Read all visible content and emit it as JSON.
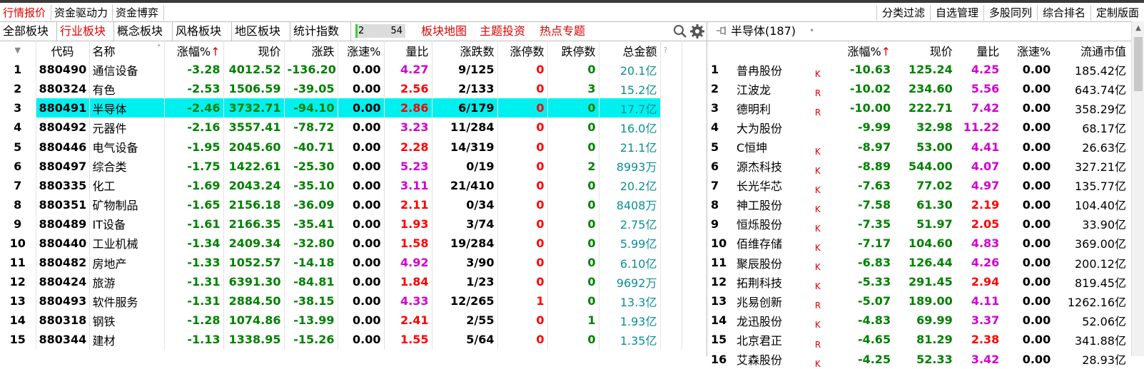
{
  "top_tabs": [
    {
      "label": "行情报价",
      "active": true
    },
    {
      "label": "资金驱动力",
      "active": false
    },
    {
      "label": "资金博弈",
      "active": false
    }
  ],
  "right_buttons": [
    "分类过滤",
    "自选管理",
    "多股同列",
    "综合排名",
    "定制版面"
  ],
  "board_tabs": [
    {
      "label": "全部板块",
      "active": false
    },
    {
      "label": "行业板块",
      "active": true
    },
    {
      "label": "概念板块",
      "active": false
    },
    {
      "label": "风格板块",
      "active": false
    },
    {
      "label": "地区板块",
      "active": false
    },
    {
      "label": "统计指数",
      "active": false
    }
  ],
  "progress": {
    "current": "2",
    "total": "54",
    "fraction": 0.04
  },
  "red_links": [
    "板块地图",
    "主题投资",
    "热点专题"
  ],
  "icons": {
    "search": "search-icon",
    "settings": "gear-icon",
    "pin": "pin-icon",
    "scroll_up": "chevron-up-icon"
  },
  "colors": {
    "up": "#ff0000",
    "down": "#008000",
    "ratio": "#d000d0",
    "amount": "#0a8f94",
    "selection": "#00f0f0",
    "active_tab": "#e00000"
  },
  "left_table": {
    "headers": [
      "",
      "代码",
      "名称",
      "涨幅%",
      "现价",
      "涨跌",
      "涨速%",
      "量比",
      "涨跌数",
      "涨停数",
      "跌停数",
      "总金额",
      "?"
    ],
    "sort_arrow": "↑",
    "selected_index": 2,
    "rows": [
      {
        "idx": "1",
        "code": "880490",
        "name": "通信设备",
        "pct": "-3.28",
        "price": "4012.52",
        "chg": "-136.20",
        "speed": "0.00",
        "ratio": "4.27",
        "ratio_color": "mag",
        "updown": "9/125",
        "limit_up": "0",
        "limit_down": "0",
        "amount": "20.1亿"
      },
      {
        "idx": "2",
        "code": "880324",
        "name": "有色",
        "pct": "-2.53",
        "price": "1506.59",
        "chg": "-39.05",
        "speed": "0.00",
        "ratio": "2.56",
        "ratio_color": "red",
        "updown": "2/133",
        "limit_up": "0",
        "limit_down": "3",
        "amount": "15.2亿"
      },
      {
        "idx": "3",
        "code": "880491",
        "name": "半导体",
        "pct": "-2.46",
        "price": "3732.71",
        "chg": "-94.10",
        "speed": "0.00",
        "ratio": "2.86",
        "ratio_color": "red",
        "updown": "6/179",
        "limit_up": "0",
        "limit_down": "0",
        "amount": "17.7亿"
      },
      {
        "idx": "4",
        "code": "880492",
        "name": "元器件",
        "pct": "-2.16",
        "price": "3557.41",
        "chg": "-78.72",
        "speed": "0.00",
        "ratio": "3.23",
        "ratio_color": "mag",
        "updown": "11/284",
        "limit_up": "0",
        "limit_down": "0",
        "amount": "16.0亿"
      },
      {
        "idx": "5",
        "code": "880446",
        "name": "电气设备",
        "pct": "-1.95",
        "price": "2045.60",
        "chg": "-40.71",
        "speed": "0.00",
        "ratio": "2.28",
        "ratio_color": "red",
        "updown": "14/319",
        "limit_up": "0",
        "limit_down": "0",
        "amount": "21.1亿"
      },
      {
        "idx": "6",
        "code": "880497",
        "name": "综合类",
        "pct": "-1.75",
        "price": "1422.61",
        "chg": "-25.30",
        "speed": "0.00",
        "ratio": "5.23",
        "ratio_color": "mag",
        "updown": "0/19",
        "limit_up": "0",
        "limit_down": "2",
        "amount": "8993万"
      },
      {
        "idx": "7",
        "code": "880335",
        "name": "化工",
        "pct": "-1.69",
        "price": "2043.24",
        "chg": "-35.10",
        "speed": "0.00",
        "ratio": "3.11",
        "ratio_color": "mag",
        "updown": "21/410",
        "limit_up": "0",
        "limit_down": "0",
        "amount": "20.2亿"
      },
      {
        "idx": "8",
        "code": "880351",
        "name": "矿物制品",
        "pct": "-1.65",
        "price": "2156.18",
        "chg": "-36.09",
        "speed": "0.00",
        "ratio": "2.11",
        "ratio_color": "red",
        "updown": "0/34",
        "limit_up": "0",
        "limit_down": "0",
        "amount": "8408万"
      },
      {
        "idx": "9",
        "code": "880489",
        "name": "IT设备",
        "pct": "-1.61",
        "price": "2166.35",
        "chg": "-35.41",
        "speed": "0.00",
        "ratio": "1.93",
        "ratio_color": "red",
        "updown": "3/74",
        "limit_up": "0",
        "limit_down": "0",
        "amount": "2.75亿"
      },
      {
        "idx": "10",
        "code": "880440",
        "name": "工业机械",
        "pct": "-1.34",
        "price": "2409.34",
        "chg": "-32.80",
        "speed": "0.00",
        "ratio": "1.58",
        "ratio_color": "red",
        "updown": "19/284",
        "limit_up": "0",
        "limit_down": "0",
        "amount": "5.99亿"
      },
      {
        "idx": "11",
        "code": "880482",
        "name": "房地产",
        "pct": "-1.33",
        "price": "1052.57",
        "chg": "-14.18",
        "speed": "0.00",
        "ratio": "4.92",
        "ratio_color": "mag",
        "updown": "3/90",
        "limit_up": "0",
        "limit_down": "0",
        "amount": "6.10亿"
      },
      {
        "idx": "12",
        "code": "880424",
        "name": "旅游",
        "pct": "-1.31",
        "price": "6391.30",
        "chg": "-84.81",
        "speed": "0.00",
        "ratio": "1.84",
        "ratio_color": "red",
        "updown": "1/23",
        "limit_up": "0",
        "limit_down": "0",
        "amount": "9692万"
      },
      {
        "idx": "13",
        "code": "880493",
        "name": "软件服务",
        "pct": "-1.31",
        "price": "2884.50",
        "chg": "-38.15",
        "speed": "0.00",
        "ratio": "4.33",
        "ratio_color": "mag",
        "updown": "12/265",
        "limit_up": "1",
        "limit_down": "0",
        "amount": "13.3亿"
      },
      {
        "idx": "14",
        "code": "880318",
        "name": "钢铁",
        "pct": "-1.28",
        "price": "1074.86",
        "chg": "-13.99",
        "speed": "0.00",
        "ratio": "2.41",
        "ratio_color": "red",
        "updown": "2/55",
        "limit_up": "0",
        "limit_down": "1",
        "amount": "1.93亿"
      },
      {
        "idx": "15",
        "code": "880344",
        "name": "建材",
        "pct": "-1.13",
        "price": "1338.95",
        "chg": "-15.26",
        "speed": "0.00",
        "ratio": "1.55",
        "ratio_color": "red",
        "updown": "5/64",
        "limit_up": "0",
        "limit_down": "0",
        "amount": "1.35亿"
      }
    ]
  },
  "right_table": {
    "title": "半导体(187)",
    "headers": [
      "涨幅%",
      "现价",
      "量比",
      "涨速%",
      "流通市值"
    ],
    "sort_arrow": "↑",
    "rows": [
      {
        "idx": "1",
        "name": "普冉股份",
        "tag": "K",
        "pct": "-10.63",
        "price": "125.24",
        "ratio": "4.25",
        "ratio_color": "mag",
        "speed": "0.00",
        "cap": "185.42亿"
      },
      {
        "idx": "2",
        "name": "江波龙",
        "tag": "R",
        "pct": "-10.02",
        "price": "234.60",
        "ratio": "5.56",
        "ratio_color": "mag",
        "speed": "0.00",
        "cap": "643.74亿"
      },
      {
        "idx": "3",
        "name": "德明利",
        "tag": "R",
        "pct": "-10.00",
        "price": "222.71",
        "ratio": "7.42",
        "ratio_color": "mag",
        "speed": "0.00",
        "cap": "358.29亿"
      },
      {
        "idx": "4",
        "name": "大为股份",
        "tag": "",
        "pct": "-9.99",
        "price": "32.98",
        "ratio": "11.22",
        "ratio_color": "mag",
        "speed": "0.00",
        "cap": "68.17亿"
      },
      {
        "idx": "5",
        "name": "C恒坤",
        "tag": "K",
        "pct": "-8.97",
        "price": "53.00",
        "ratio": "4.41",
        "ratio_color": "mag",
        "speed": "0.00",
        "cap": "26.63亿"
      },
      {
        "idx": "6",
        "name": "源杰科技",
        "tag": "K",
        "pct": "-8.89",
        "price": "544.00",
        "ratio": "4.07",
        "ratio_color": "mag",
        "speed": "0.00",
        "cap": "327.21亿"
      },
      {
        "idx": "7",
        "name": "长光华芯",
        "tag": "K",
        "pct": "-7.63",
        "price": "77.02",
        "ratio": "4.97",
        "ratio_color": "mag",
        "speed": "0.00",
        "cap": "135.77亿"
      },
      {
        "idx": "8",
        "name": "神工股份",
        "tag": "K",
        "pct": "-7.58",
        "price": "61.30",
        "ratio": "2.19",
        "ratio_color": "red",
        "speed": "0.00",
        "cap": "104.40亿"
      },
      {
        "idx": "9",
        "name": "恒烁股份",
        "tag": "K",
        "pct": "-7.35",
        "price": "51.97",
        "ratio": "2.05",
        "ratio_color": "red",
        "speed": "0.00",
        "cap": "33.90亿"
      },
      {
        "idx": "10",
        "name": "佰维存储",
        "tag": "K",
        "pct": "-7.17",
        "price": "104.60",
        "ratio": "4.83",
        "ratio_color": "mag",
        "speed": "0.00",
        "cap": "369.00亿"
      },
      {
        "idx": "11",
        "name": "聚辰股份",
        "tag": "K",
        "pct": "-6.83",
        "price": "126.44",
        "ratio": "4.26",
        "ratio_color": "mag",
        "speed": "0.00",
        "cap": "200.12亿"
      },
      {
        "idx": "12",
        "name": "拓荆科技",
        "tag": "K",
        "pct": "-5.33",
        "price": "291.45",
        "ratio": "2.94",
        "ratio_color": "red",
        "speed": "0.00",
        "cap": "819.45亿"
      },
      {
        "idx": "13",
        "name": "兆易创新",
        "tag": "R",
        "pct": "-5.07",
        "price": "189.00",
        "ratio": "4.11",
        "ratio_color": "mag",
        "speed": "0.00",
        "cap": "1262.16亿"
      },
      {
        "idx": "14",
        "name": "龙迅股份",
        "tag": "K",
        "pct": "-4.83",
        "price": "69.99",
        "ratio": "3.37",
        "ratio_color": "mag",
        "speed": "0.00",
        "cap": "52.06亿"
      },
      {
        "idx": "15",
        "name": "北京君正",
        "tag": "R",
        "pct": "-4.65",
        "price": "81.29",
        "ratio": "2.38",
        "ratio_color": "red",
        "speed": "0.00",
        "cap": "341.88亿"
      },
      {
        "idx": "16",
        "name": "艾森股份",
        "tag": "K",
        "pct": "-4.25",
        "price": "52.33",
        "ratio": "3.42",
        "ratio_color": "mag",
        "speed": "0.00",
        "cap": "28.93亿"
      }
    ]
  }
}
